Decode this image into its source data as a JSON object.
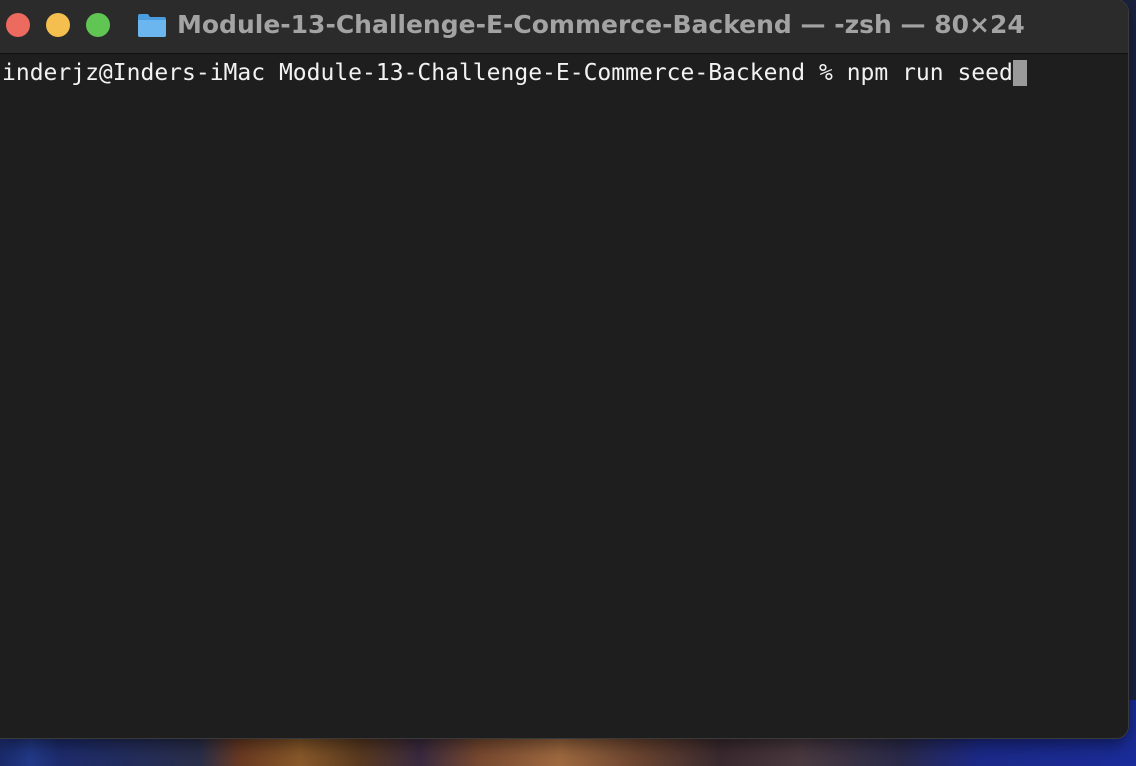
{
  "window": {
    "title": "Module-13-Challenge-E-Commerce-Backend — -zsh — 80×24",
    "folder_icon": "folder-icon",
    "traffic_lights": {
      "close_color": "#ec6a5e",
      "minimize_color": "#f4bf4f",
      "zoom_color": "#61c554"
    }
  },
  "terminal": {
    "background": "#1e1e1e",
    "foreground": "#f2f2f2",
    "lines": [
      {
        "prompt": "inderjz@Inders-iMac Module-13-Challenge-E-Commerce-Backend % ",
        "command": "npm run seed"
      }
    ]
  }
}
